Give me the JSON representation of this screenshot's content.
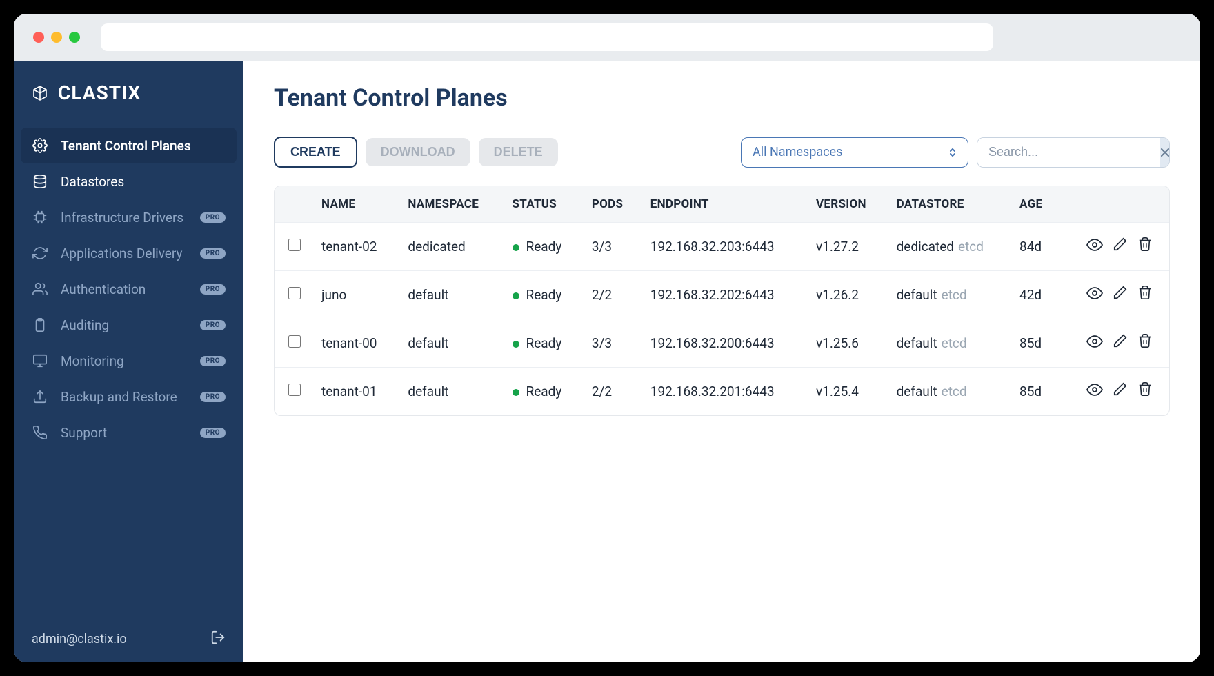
{
  "brand": {
    "name": "CLASTIX"
  },
  "sidebar": {
    "items": [
      {
        "label": "Tenant Control Planes",
        "icon": "gear",
        "active": true,
        "pro": false
      },
      {
        "label": "Datastores",
        "icon": "database",
        "active": false,
        "pro": false
      },
      {
        "label": "Infrastructure Drivers",
        "icon": "chip",
        "active": false,
        "pro": true
      },
      {
        "label": "Applications Delivery",
        "icon": "refresh",
        "active": false,
        "pro": true
      },
      {
        "label": "Authentication",
        "icon": "users",
        "active": false,
        "pro": true
      },
      {
        "label": "Auditing",
        "icon": "clipboard",
        "active": false,
        "pro": true
      },
      {
        "label": "Monitoring",
        "icon": "monitor",
        "active": false,
        "pro": true
      },
      {
        "label": "Backup and Restore",
        "icon": "upload",
        "active": false,
        "pro": true
      },
      {
        "label": "Support",
        "icon": "phone",
        "active": false,
        "pro": true
      }
    ],
    "pro_badge": "PRO",
    "footer_user": "admin@clastix.io"
  },
  "page": {
    "title": "Tenant Control Planes"
  },
  "toolbar": {
    "create": "CREATE",
    "download": "DOWNLOAD",
    "delete": "DELETE",
    "namespace_selected": "All Namespaces",
    "search_placeholder": "Search..."
  },
  "table": {
    "headers": {
      "name": "NAME",
      "namespace": "NAMESPACE",
      "status": "STATUS",
      "pods": "PODS",
      "endpoint": "ENDPOINT",
      "version": "VERSION",
      "datastore": "DATASTORE",
      "age": "AGE"
    },
    "rows": [
      {
        "name": "tenant-02",
        "namespace": "dedicated",
        "status": "Ready",
        "pods": "3/3",
        "endpoint": "192.168.32.203:6443",
        "version": "v1.27.2",
        "datastore": "dedicated",
        "datastore_type": "etcd",
        "age": "84d"
      },
      {
        "name": "juno",
        "namespace": "default",
        "status": "Ready",
        "pods": "2/2",
        "endpoint": "192.168.32.202:6443",
        "version": "v1.26.2",
        "datastore": "default",
        "datastore_type": "etcd",
        "age": "42d"
      },
      {
        "name": "tenant-00",
        "namespace": "default",
        "status": "Ready",
        "pods": "3/3",
        "endpoint": "192.168.32.200:6443",
        "version": "v1.25.6",
        "datastore": "default",
        "datastore_type": "etcd",
        "age": "85d"
      },
      {
        "name": "tenant-01",
        "namespace": "default",
        "status": "Ready",
        "pods": "2/2",
        "endpoint": "192.168.32.201:6443",
        "version": "v1.25.4",
        "datastore": "default",
        "datastore_type": "etcd",
        "age": "85d"
      }
    ]
  }
}
